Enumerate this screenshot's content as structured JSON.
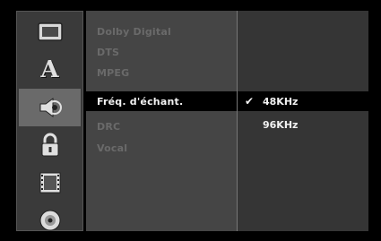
{
  "sidebar": {
    "items": [
      {
        "icon": "monitor-icon",
        "selected": false
      },
      {
        "icon": "language-a-icon",
        "label": "A",
        "selected": false
      },
      {
        "icon": "audio-speaker-icon",
        "selected": true
      },
      {
        "icon": "lock-icon",
        "selected": false
      },
      {
        "icon": "film-icon",
        "selected": false
      },
      {
        "icon": "disc-icon",
        "selected": false
      }
    ]
  },
  "menu": {
    "items": [
      {
        "label": "Dolby Digital"
      },
      {
        "label": "DTS"
      },
      {
        "label": "MPEG"
      },
      {
        "label": "Fréq. d'échant."
      },
      {
        "label": "DRC"
      },
      {
        "label": "Vocal"
      }
    ],
    "active_index": 3
  },
  "options": {
    "items": [
      {
        "label": "48KHz",
        "checked": true
      },
      {
        "label": "96KHz",
        "checked": false
      }
    ],
    "check_glyph": "✔"
  },
  "colors": {
    "background": "#000000",
    "panel": "#3b3b3b",
    "highlight": "#000000",
    "text_active": "#f2f2f2",
    "text_disabled": "#6a6a6a"
  }
}
